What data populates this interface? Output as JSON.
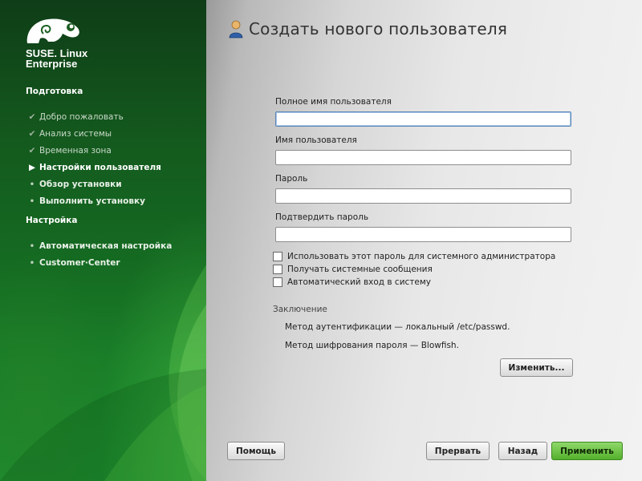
{
  "sidebar": {
    "brand_line1": "SUSE. Linux",
    "brand_line2": "Enterprise",
    "sections": [
      {
        "title": "Подготовка",
        "steps": [
          {
            "label": "Добро пожаловать",
            "state": "done"
          },
          {
            "label": "Анализ системы",
            "state": "done"
          },
          {
            "label": "Временная зона",
            "state": "done"
          },
          {
            "label": "Настройки пользователя",
            "state": "current"
          },
          {
            "label": "Обзор установки",
            "state": "todo"
          },
          {
            "label": "Выполнить установку",
            "state": "todo"
          }
        ]
      },
      {
        "title": "Настройка",
        "steps": [
          {
            "label": "Автоматическая настройка",
            "state": "todo"
          },
          {
            "label": "Customer·Center",
            "state": "todo"
          }
        ]
      }
    ],
    "markers": {
      "done": "✔",
      "current": "▶",
      "todo": "•"
    }
  },
  "main": {
    "title": "Создать нового пользователя",
    "fields": [
      {
        "label": "Полное имя пользователя",
        "value": ""
      },
      {
        "label": "Имя пользователя",
        "value": ""
      },
      {
        "label": "Пароль",
        "value": ""
      },
      {
        "label": "Подтвердить пароль",
        "value": ""
      }
    ],
    "checkboxes": [
      {
        "label": "Использовать этот пароль для системного администратора",
        "checked": false
      },
      {
        "label": "Получать системные сообщения",
        "checked": false
      },
      {
        "label": "Автоматический вход в систему",
        "checked": false
      }
    ],
    "summary": {
      "title": "Заключение",
      "lines": [
        "Метод аутентификации — локальный /etc/passwd.",
        "Метод шифрования пароля — Blowfish."
      ]
    },
    "change_button": "Изменить..."
  },
  "footer": {
    "help": "Помощь",
    "abort": "Прервать",
    "back": "Назад",
    "accept": "Применить"
  },
  "colors": {
    "sidebar_green": "#156b22",
    "accept_green": "#54b02c"
  }
}
